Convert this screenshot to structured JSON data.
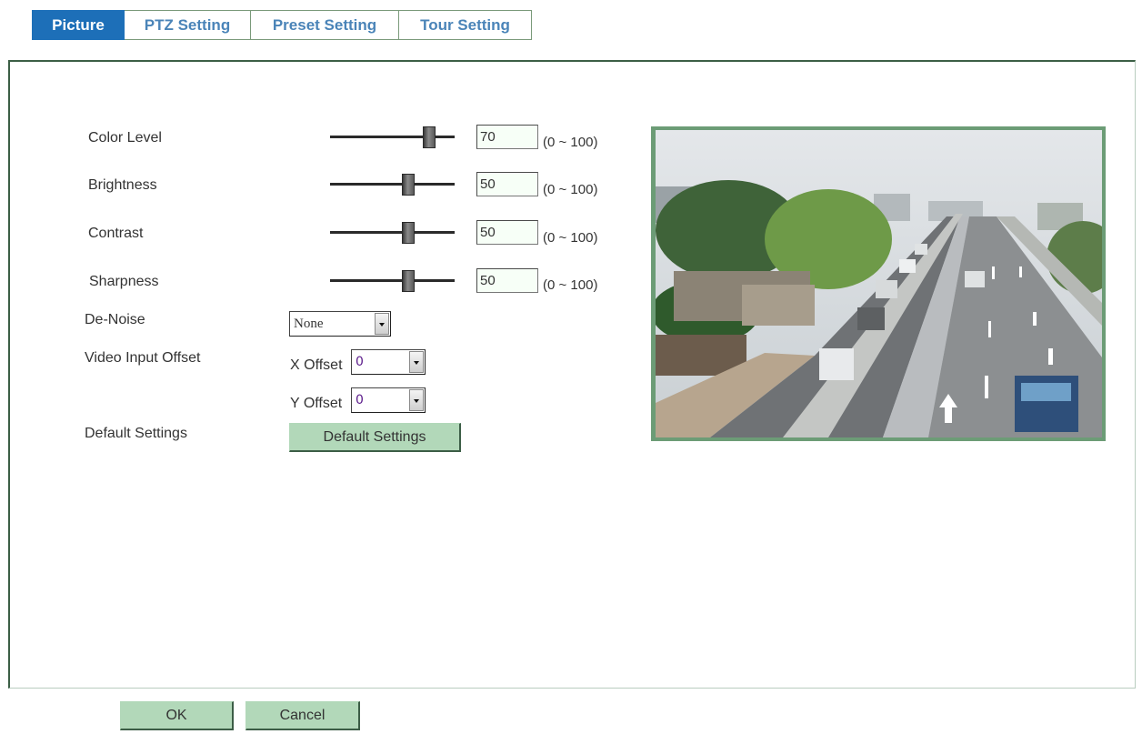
{
  "tabs": [
    {
      "label": "Picture",
      "active": true
    },
    {
      "label": "PTZ Setting",
      "active": false
    },
    {
      "label": "Preset Setting",
      "active": false
    },
    {
      "label": "Tour Setting",
      "active": false
    }
  ],
  "picture": {
    "sliders": [
      {
        "label": "Color Level",
        "value": "70",
        "range": "(0 ~ 100)",
        "level_percent": 70
      },
      {
        "label": "Brightness",
        "value": "50",
        "range": "(0 ~ 100)",
        "level_percent": 50
      },
      {
        "label": "Contrast",
        "value": "50",
        "range": "(0 ~ 100)",
        "level_percent": 50
      },
      {
        "label": "Sharpness",
        "value": "50",
        "range": "(0 ~ 100)",
        "level_percent": 50
      }
    ],
    "denoise": {
      "label": "De-Noise",
      "selected": "None"
    },
    "video_input_offset": {
      "label": "Video Input Offset",
      "x_label": "X Offset",
      "x_value": "0",
      "y_label": "Y Offset",
      "y_value": "0"
    },
    "default_settings": {
      "label": "Default Settings",
      "button_label": "Default Settings"
    }
  },
  "footer": {
    "ok_label": "OK",
    "cancel_label": "Cancel"
  },
  "colors": {
    "tab_active_bg": "#1d6fb8",
    "tab_text": "#4a84b8",
    "button_bg": "#b2d8b9",
    "panel_border": "#3c5f46",
    "preview_border": "#6c9c76"
  }
}
